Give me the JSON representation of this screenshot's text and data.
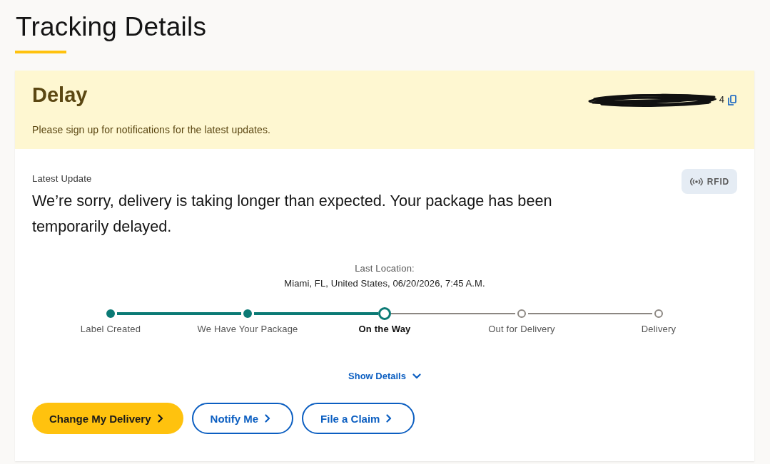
{
  "page": {
    "title": "Tracking Details"
  },
  "status_banner": {
    "status": "Delay",
    "message": "Please sign up for notifications for the latest updates.",
    "tracking_number": {
      "visible_text": "4",
      "redacted": true
    }
  },
  "latest_update": {
    "label": "Latest Update",
    "message": "We’re sorry, delivery is taking longer than expected. Your package has been temporarily delayed.",
    "rfid_badge": "RFID"
  },
  "last_location": {
    "label": "Last Location:",
    "value": "Miami, FL, United States, 06/20/2026, 7:45 A.M."
  },
  "progress": {
    "steps": [
      {
        "label": "Label Created",
        "completed": true,
        "current": false
      },
      {
        "label": "We Have Your Package",
        "completed": true,
        "current": false
      },
      {
        "label": "On the Way",
        "completed": false,
        "current": true
      },
      {
        "label": "Out for Delivery",
        "completed": false,
        "current": false
      },
      {
        "label": "Delivery",
        "completed": false,
        "current": false
      }
    ]
  },
  "show_details": {
    "label": "Show Details",
    "expanded": false
  },
  "actions": [
    {
      "label": "Change My Delivery",
      "kind": "primary"
    },
    {
      "label": "Notify Me",
      "kind": "secondary"
    },
    {
      "label": "File a Claim",
      "kind": "secondary"
    }
  ]
}
